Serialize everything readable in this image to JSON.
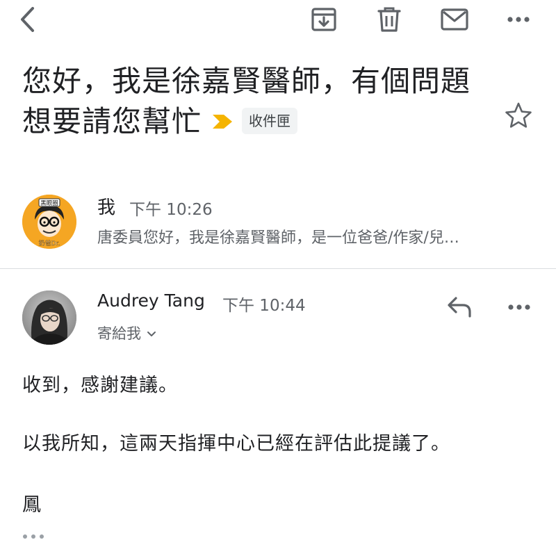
{
  "thread": {
    "subject": "您好，我是徐嘉賢醫師，有個問題想要請您幫忙",
    "label": "收件匣"
  },
  "messages": [
    {
      "sender": "我",
      "time": "下午 10:26",
      "snippet": "唐委員您好，我是徐嘉賢醫師，是一位爸爸/作家/兒…",
      "avatar": {
        "badge_top": "黑眼圈",
        "badge_bottom": "奶爸Dr."
      }
    },
    {
      "sender": "Audrey Tang",
      "time": "下午 10:44",
      "recipient": "寄給我",
      "body": [
        "收到，感謝建議。",
        "以我所知，這兩天指揮中心已經在評估此提議了。",
        "鳳"
      ]
    }
  ],
  "icons": {
    "back": "chevron-left-icon",
    "archive": "archive-icon",
    "delete": "trash-icon",
    "mark_unread": "mail-icon",
    "more": "more-horizontal-icon",
    "importance": "importance-marker-icon",
    "star": "star-outline-icon",
    "reply": "reply-icon"
  },
  "colors": {
    "importance": "#f5b400",
    "avatar_bg": "#f5a623",
    "text_primary": "#202124",
    "text_secondary": "#5f6368",
    "icon": "#5f6368"
  }
}
